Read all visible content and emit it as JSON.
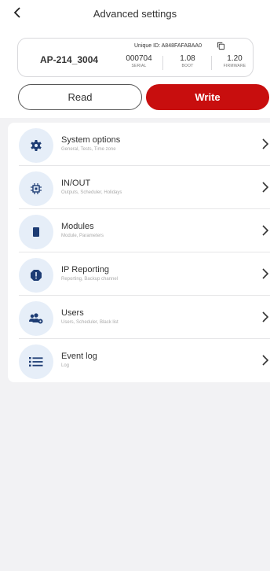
{
  "header": {
    "title": "Advanced settings"
  },
  "device": {
    "model": "AP-214_3004",
    "unique_id_label": "Unique ID: A848FAFABAA0",
    "stats": [
      {
        "value": "000704",
        "label": "SERIAL"
      },
      {
        "value": "1.08",
        "label": "BOOT"
      },
      {
        "value": "1.20",
        "label": "FIRMWARE"
      }
    ]
  },
  "actions": {
    "read_label": "Read",
    "write_label": "Write"
  },
  "colors": {
    "accent": "#c80e0e",
    "icon": "#1d3c74",
    "icon_bg": "#e6eef8"
  },
  "menu": [
    {
      "title": "System options",
      "subtitle": "General, Tests, Time zone",
      "icon": "gear-icon"
    },
    {
      "title": "IN/OUT",
      "subtitle": "Outputs, Scheduler, Holidays",
      "icon": "chip-icon"
    },
    {
      "title": "Modules",
      "subtitle": "Module, Parameters",
      "icon": "module-icon"
    },
    {
      "title": "IP Reporting",
      "subtitle": "Reporting, Backup channel",
      "icon": "alert-icon"
    },
    {
      "title": "Users",
      "subtitle": "Users, Scheduler, Black list",
      "icon": "users-icon"
    },
    {
      "title": "Event log",
      "subtitle": "Log",
      "icon": "list-icon"
    }
  ]
}
